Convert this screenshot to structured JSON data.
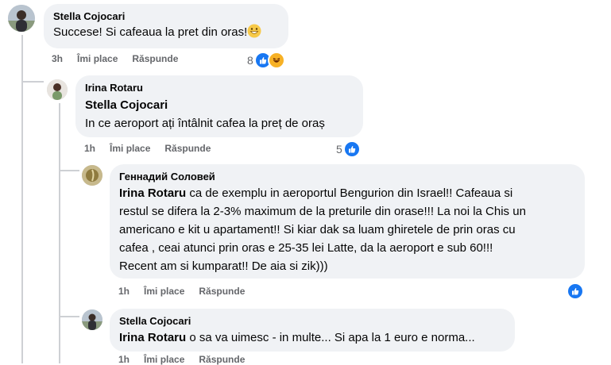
{
  "comments": [
    {
      "author": "Stella Cojocari",
      "mention": "",
      "text": "Succese! Si cafeaua la pret din oras!",
      "time": "3h",
      "like_label": "Îmi place",
      "reply_label": "Răspunde",
      "reaction_count": "8",
      "reaction_icons": [
        "like-icon",
        "haha-icon"
      ]
    },
    {
      "author": "Irina Rotaru",
      "mention": "Stella Cojocari",
      "text": "In ce aeroport ați întâlnit cafea la preț de oraș",
      "time": "1h",
      "like_label": "Îmi place",
      "reply_label": "Răspunde",
      "reaction_count": "5",
      "reaction_icons": [
        "like-icon"
      ]
    },
    {
      "author": "Геннадий Соловей",
      "mention": "Irina Rotaru",
      "text_lines": [
        " ca de exemplu in aeroportul Bengurion din Israel!! Cafeaua si",
        "restul se difera la 2-3% maximum de la preturile din orase!!! La noi la Chis un",
        "americano e kit u apartament!! Si kiar dak sa luam ghiretele de prin oras cu",
        "cafea , ceai atunci prin oras e 25-35 lei Latte, da la aeroport e sub 60!!!",
        "Recent am si kumparat!! De aia si zik)))"
      ],
      "time": "1h",
      "like_label": "Îmi place",
      "reply_label": "Răspunde",
      "reaction_count": "",
      "reaction_icons": [
        "like-icon"
      ]
    },
    {
      "author": "Stella Cojocari",
      "mention": "Irina Rotaru",
      "text": " o sa va uimesc - in multe... Si apa la 1 euro e norma...",
      "time": "1h",
      "like_label": "Îmi place",
      "reply_label": "Răspunde"
    }
  ],
  "colors": {
    "bubble": "#f0f2f5",
    "like": "#1877f2",
    "haha": "#f7b125",
    "meta": "#65676b",
    "thread_line": "#ced0d4"
  }
}
